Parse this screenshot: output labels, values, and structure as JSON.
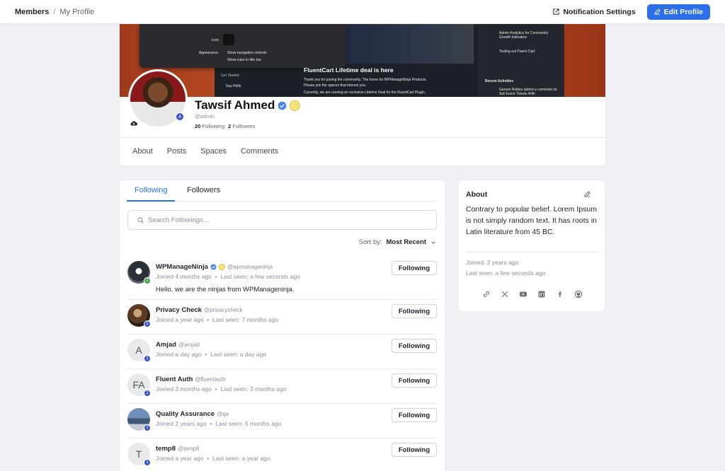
{
  "topbar": {
    "breadcrumb_root": "Members",
    "breadcrumb_sep": "/",
    "breadcrumb_current": "My Profile",
    "notification_label": "Notification Settings",
    "edit_profile_label": "Edit Profile"
  },
  "cover": {
    "headline": "FluentCart Lifetime deal is here",
    "snippet1": "Thank you for joining the community. The home for WPManageNinja Products.",
    "snippet2": "Please join the spaces that interest you.",
    "snippet3": "Currently, we are running an exclusive Lifetime Deal for the FluentCart Plugin.",
    "get_started": "Get Started",
    "say_hello": "Say Hello",
    "icon_label": "Icon:",
    "appearance_label": "Appearance:",
    "appearance_opt1": "Show navigation controls",
    "appearance_opt2": "Show color in title bar",
    "feed1": "Admin Analytics for Community Growth Indicators",
    "feed2": "Testing out Fluent Cart",
    "recent_activities": "Recent Activities",
    "activity1": "Gerson Robles added a comment on Sell Event Tickets With"
  },
  "profile": {
    "name": "Tawsif Ahmed",
    "handle": "@admin",
    "level": "4",
    "following_count": "20",
    "following_label": "Following",
    "followers_count": "2",
    "followers_label": "Followers",
    "tabs": [
      "About",
      "Posts",
      "Spaces",
      "Comments"
    ]
  },
  "follow_panel": {
    "tabs": [
      "Following",
      "Followers"
    ],
    "search_placeholder": "Search Followings...",
    "sort_label": "Sort by:",
    "sort_value": "Most Recent",
    "button_label": "Following",
    "members": [
      {
        "name": "WPManageNinja",
        "handle": "@wpmanageninja",
        "initials": "",
        "level": "2",
        "joined": "Joined 4 months ago",
        "last_seen": "Last seen: a few seconds ago",
        "bio": "Hello, we are the ninjas from WPManageninja."
      },
      {
        "name": "Privacy Check",
        "handle": "@privacycheck",
        "initials": "",
        "level": "2",
        "joined": "Joined a year ago",
        "last_seen": "Last seen: 7 months ago",
        "bio": ""
      },
      {
        "name": "Amjad",
        "handle": "@amjad",
        "initials": "A",
        "level": "1",
        "joined": "Joined a day ago",
        "last_seen": "Last seen: a day ago",
        "bio": ""
      },
      {
        "name": "Fluent Auth",
        "handle": "@fluentauth",
        "initials": "FA",
        "level": "1",
        "joined": "Joined 3 months ago",
        "last_seen": "Last seen: 3 months ago",
        "bio": ""
      },
      {
        "name": "Quality Assurance",
        "handle": "@qa",
        "initials": "",
        "level": "2",
        "joined": "Joined 2 years ago",
        "last_seen": "Last seen: 6 months ago",
        "bio": ""
      },
      {
        "name": "temp8",
        "handle": "@temp8",
        "initials": "T",
        "level": "1",
        "joined": "Joined a year ago",
        "last_seen": "Last seen: a year ago",
        "bio": ""
      }
    ]
  },
  "about": {
    "title": "About",
    "text": "Contrary to popular belief. Lorem Ipsum is not simply random text. It has roots in Latin literature from 45 BC.",
    "joined": "Joined: 2 years ago",
    "last_seen": "Last seen: a few seconds ago",
    "socials": [
      "link-icon",
      "x-icon",
      "youtube-icon",
      "linkedin-icon",
      "facebook-icon",
      "github-icon"
    ]
  },
  "colors": {
    "accent": "#2c6fe9",
    "level_badge": "#3b56c4",
    "level_badge_alt": "#46a64a"
  }
}
